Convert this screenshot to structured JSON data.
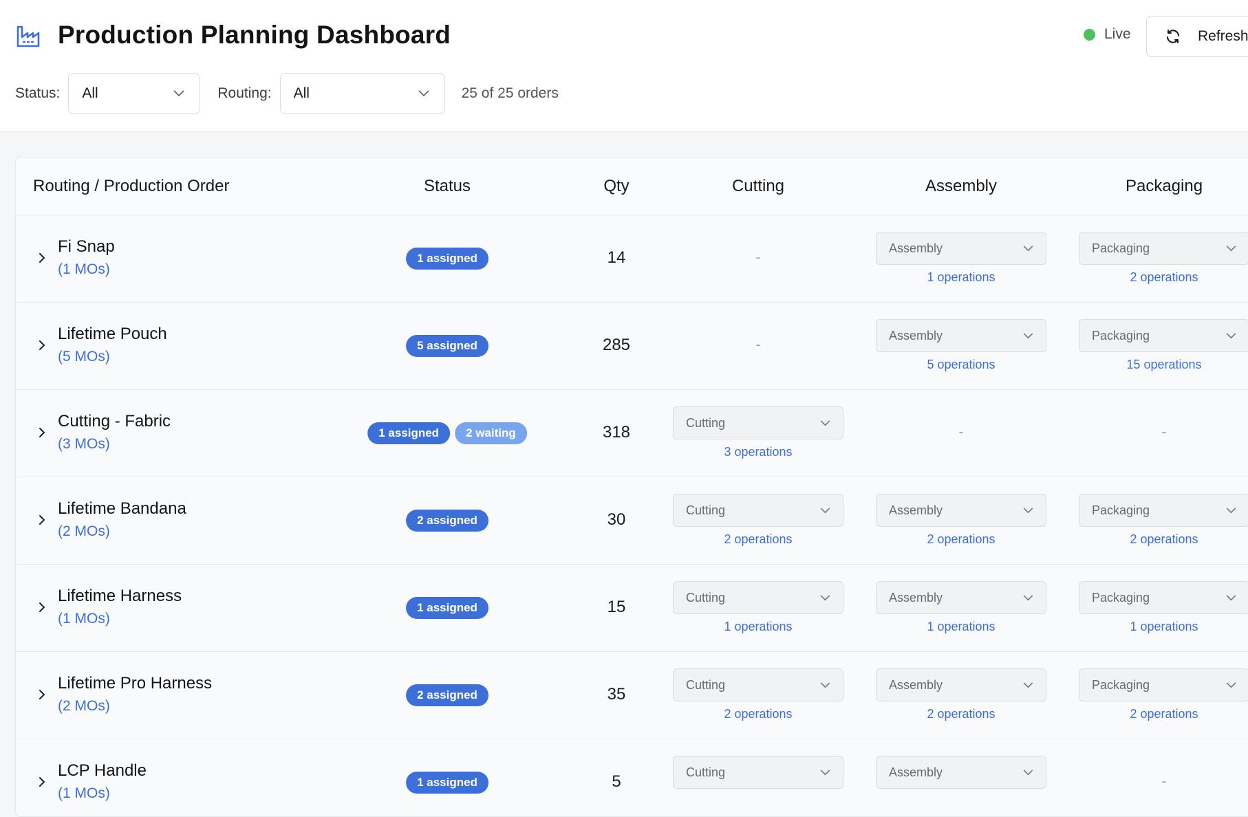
{
  "header": {
    "title": "Production Planning Dashboard",
    "logo_icon": "factory-chart-icon",
    "live_label": "Live",
    "live_color": "#4cc15d",
    "refresh_label": "Refresh"
  },
  "filters": {
    "status_label": "Status:",
    "status_value": "All",
    "routing_label": "Routing:",
    "routing_value": "All",
    "order_count": "25 of 25 orders"
  },
  "table": {
    "columns": {
      "routing": "Routing / Production Order",
      "status": "Status",
      "qty": "Qty",
      "cutting": "Cutting",
      "assembly": "Assembly",
      "packaging": "Packaging"
    },
    "dash": "-",
    "rows": [
      {
        "name": "Fi Snap",
        "mos": "(1 MOs)",
        "badges": [
          {
            "text": "1 assigned",
            "kind": "assigned"
          }
        ],
        "qty": "14",
        "cutting": null,
        "assembly": {
          "label": "Assembly",
          "ops": "1 operations"
        },
        "packaging": {
          "label": "Packaging",
          "ops": "2 operations"
        }
      },
      {
        "name": "Lifetime Pouch",
        "mos": "(5 MOs)",
        "badges": [
          {
            "text": "5 assigned",
            "kind": "assigned"
          }
        ],
        "qty": "285",
        "cutting": null,
        "assembly": {
          "label": "Assembly",
          "ops": "5 operations"
        },
        "packaging": {
          "label": "Packaging",
          "ops": "15 operations"
        }
      },
      {
        "name": "Cutting - Fabric",
        "mos": "(3 MOs)",
        "badges": [
          {
            "text": "1 assigned",
            "kind": "assigned"
          },
          {
            "text": "2 waiting",
            "kind": "waiting"
          }
        ],
        "qty": "318",
        "cutting": {
          "label": "Cutting",
          "ops": "3 operations"
        },
        "assembly": null,
        "packaging": null
      },
      {
        "name": "Lifetime Bandana",
        "mos": "(2 MOs)",
        "badges": [
          {
            "text": "2 assigned",
            "kind": "assigned"
          }
        ],
        "qty": "30",
        "cutting": {
          "label": "Cutting",
          "ops": "2 operations"
        },
        "assembly": {
          "label": "Assembly",
          "ops": "2 operations"
        },
        "packaging": {
          "label": "Packaging",
          "ops": "2 operations"
        }
      },
      {
        "name": "Lifetime Harness",
        "mos": "(1 MOs)",
        "badges": [
          {
            "text": "1 assigned",
            "kind": "assigned"
          }
        ],
        "qty": "15",
        "cutting": {
          "label": "Cutting",
          "ops": "1 operations"
        },
        "assembly": {
          "label": "Assembly",
          "ops": "1 operations"
        },
        "packaging": {
          "label": "Packaging",
          "ops": "1 operations"
        }
      },
      {
        "name": "Lifetime Pro Harness",
        "mos": "(2 MOs)",
        "badges": [
          {
            "text": "2 assigned",
            "kind": "assigned"
          }
        ],
        "qty": "35",
        "cutting": {
          "label": "Cutting",
          "ops": "2 operations"
        },
        "assembly": {
          "label": "Assembly",
          "ops": "2 operations"
        },
        "packaging": {
          "label": "Packaging",
          "ops": "2 operations"
        }
      },
      {
        "name": "LCP Handle",
        "mos": "(1 MOs)",
        "badges": [
          {
            "text": "1 assigned",
            "kind": "assigned"
          }
        ],
        "qty": "5",
        "cutting": {
          "label": "Cutting",
          "ops": ""
        },
        "assembly": {
          "label": "Assembly",
          "ops": ""
        },
        "packaging": null
      }
    ]
  }
}
